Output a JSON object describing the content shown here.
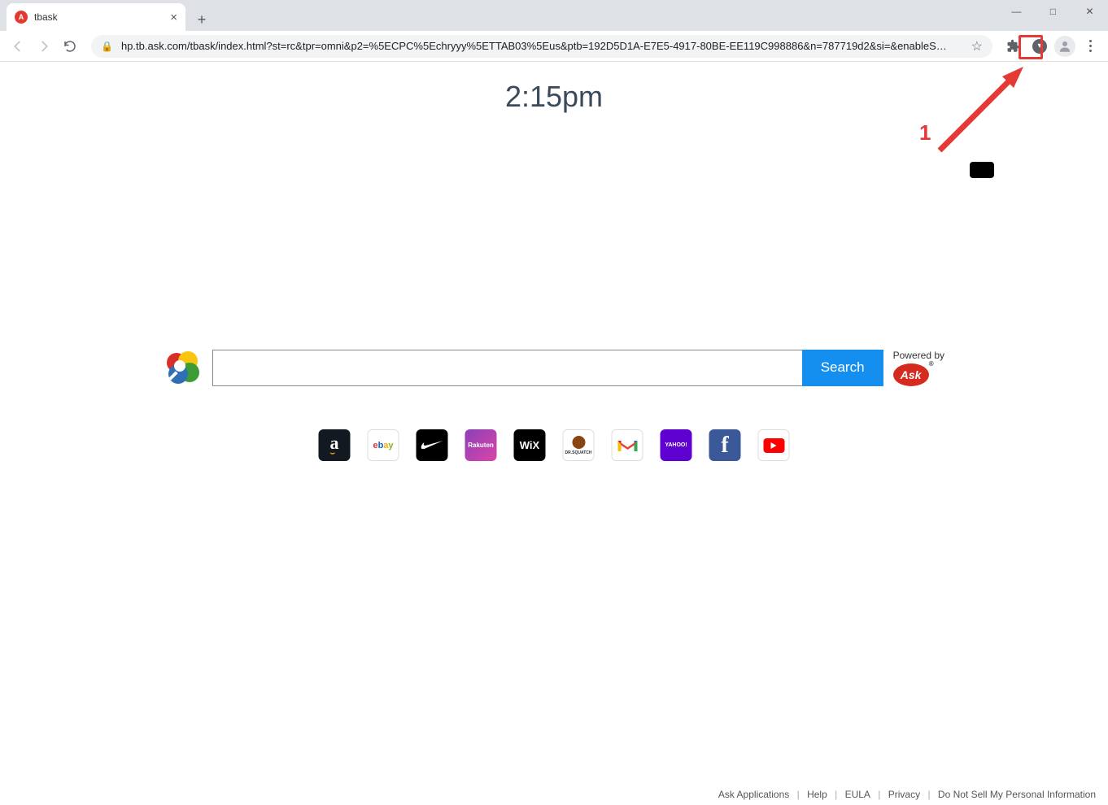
{
  "window": {
    "minimize": "—",
    "maximize": "□",
    "close": "✕"
  },
  "tab": {
    "title": "tbask",
    "favicon": "Ask"
  },
  "toolbar": {
    "url": "hp.tb.ask.com/tbask/index.html?st=rc&tpr=omni&p2=%5ECPC%5Echryyy%5ETTAB03%5Eus&ptb=192D5D1A-E7E5-4917-80BE-EE119C998886&n=787719d2&si=&enableS…"
  },
  "page": {
    "time": "2:15pm",
    "search_btn": "Search",
    "powered_by": "Powered by",
    "ask_label": "Ask"
  },
  "tiles": [
    {
      "name": "amazon",
      "label": "a"
    },
    {
      "name": "ebay",
      "label": "ebay"
    },
    {
      "name": "nike",
      "label": ""
    },
    {
      "name": "rakuten",
      "label": "Rakuten"
    },
    {
      "name": "wix",
      "label": "WiX"
    },
    {
      "name": "drsquatch",
      "label": "DR.SQUATCH"
    },
    {
      "name": "gmail",
      "label": "M"
    },
    {
      "name": "yahoo",
      "label": "YAHOO!"
    },
    {
      "name": "facebook",
      "label": "f"
    },
    {
      "name": "youtube",
      "label": "▶"
    }
  ],
  "footer": {
    "links": [
      "Ask Applications",
      "Help",
      "EULA",
      "Privacy",
      "Do Not Sell My Personal Information"
    ]
  },
  "annotation": {
    "number": "1"
  }
}
